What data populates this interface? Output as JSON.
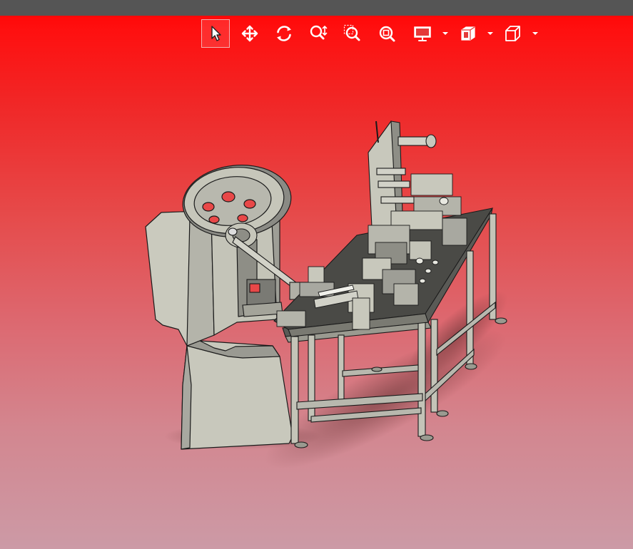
{
  "app": {
    "title": ""
  },
  "toolbar": {
    "tools": [
      {
        "id": "select",
        "icon": "pointer-arrow-icon",
        "active": true
      },
      {
        "id": "pan",
        "icon": "move-arrows-icon",
        "active": false
      },
      {
        "id": "rotate",
        "icon": "rotate-icon",
        "active": false
      },
      {
        "id": "zoom",
        "icon": "zoom-icon",
        "active": false
      },
      {
        "id": "zoom-window",
        "icon": "zoom-window-icon",
        "active": false
      },
      {
        "id": "zoom-fit",
        "icon": "zoom-fit-icon",
        "active": false
      },
      {
        "id": "display",
        "icon": "monitor-icon",
        "active": false,
        "dropdown": true
      },
      {
        "id": "section",
        "icon": "section-view-icon",
        "active": false,
        "dropdown": true
      },
      {
        "id": "view-orientation",
        "icon": "cube-view-icon",
        "active": false,
        "dropdown": true
      }
    ]
  },
  "viewport": {
    "model": "punch-press-feeder-assembly",
    "background_top": "#ff0000",
    "background_bottom": "#cc9aa6",
    "part_color": "#c8c8bc",
    "edge_color": "#1a1a1a"
  }
}
